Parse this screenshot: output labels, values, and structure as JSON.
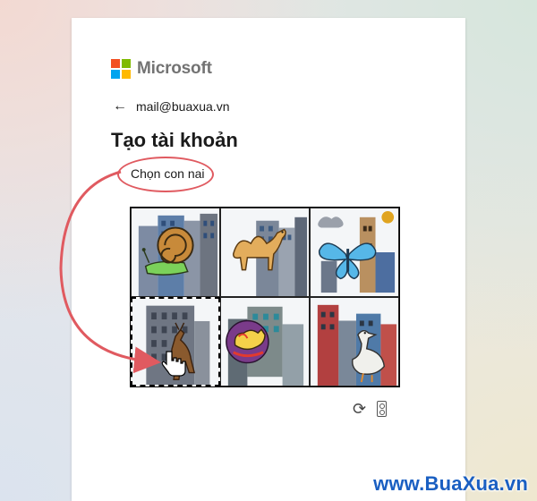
{
  "brand": {
    "name": "Microsoft",
    "colors": [
      "#f25022",
      "#7fba00",
      "#00a4ef",
      "#ffb900"
    ]
  },
  "account": {
    "email": "mail@buaxua.vn",
    "back_icon": "arrow-left-icon"
  },
  "page": {
    "title": "Tạo tài khoản"
  },
  "challenge": {
    "instruction": "Chọn con nai",
    "tiles": [
      {
        "depicts": "snail",
        "selected": false
      },
      {
        "depicts": "camel",
        "selected": false
      },
      {
        "depicts": "butterfly",
        "selected": false
      },
      {
        "depicts": "deer",
        "selected": true
      },
      {
        "depicts": "toy-horse",
        "selected": false
      },
      {
        "depicts": "goose",
        "selected": false
      }
    ],
    "controls": {
      "refresh_icon": "refresh-icon",
      "audio_icon": "audio-icon"
    }
  },
  "annotation": {
    "color": "#e05a60"
  },
  "watermark": "www.BuaXua.vn"
}
